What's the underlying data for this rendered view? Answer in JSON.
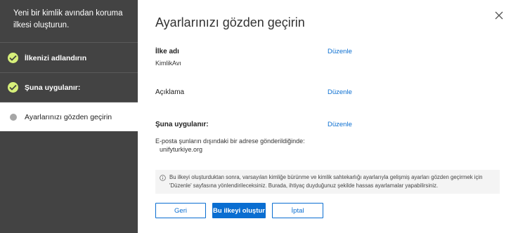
{
  "sidebar": {
    "title": "Yeni bir kimlik avından koruma ilkesi oluşturun.",
    "steps": [
      {
        "label": "İlkenizi adlandırın",
        "status": "done"
      },
      {
        "label": "Şuna uygulanır:",
        "status": "done"
      },
      {
        "label": "Ayarlarınızı gözden geçirin",
        "status": "current"
      }
    ]
  },
  "main": {
    "title": "Ayarlarınızı gözden geçirin",
    "close_icon": "close-icon",
    "sections": {
      "policy_name": {
        "label": "İlke adı",
        "value": "KimlikAvı",
        "edit": "Düzenle"
      },
      "description": {
        "label": "Açıklama",
        "edit": "Düzenle"
      },
      "applies_to": {
        "label": "Şuna uygulanır:",
        "condition": "E-posta şunların dışındaki bir adrese gönderildiğinde:",
        "value": "unifyturkiye.org",
        "edit": "Düzenle"
      }
    },
    "note": {
      "line1": "Bu ilkeyi oluşturduktan sonra, varsayılan kimliğe bürünme ve kimlik sahtekarlığı ayarlarıyla gelişmiş ayarları gözden geçirmek için",
      "line2": "'Düzenle' sayfasına yönlendirileceksiniz. Burada, ihtiyaç duyduğunuz şekilde hassas ayarlamalar yapabilirsiniz."
    },
    "buttons": {
      "back": "Geri",
      "create": "Bu ilkeyi oluştur",
      "cancel": "İptal"
    }
  },
  "colors": {
    "sidebar_bg": "#434343",
    "accent": "#0a6ed1",
    "check": "#d7f07a",
    "pending": "#a6a6a6"
  }
}
